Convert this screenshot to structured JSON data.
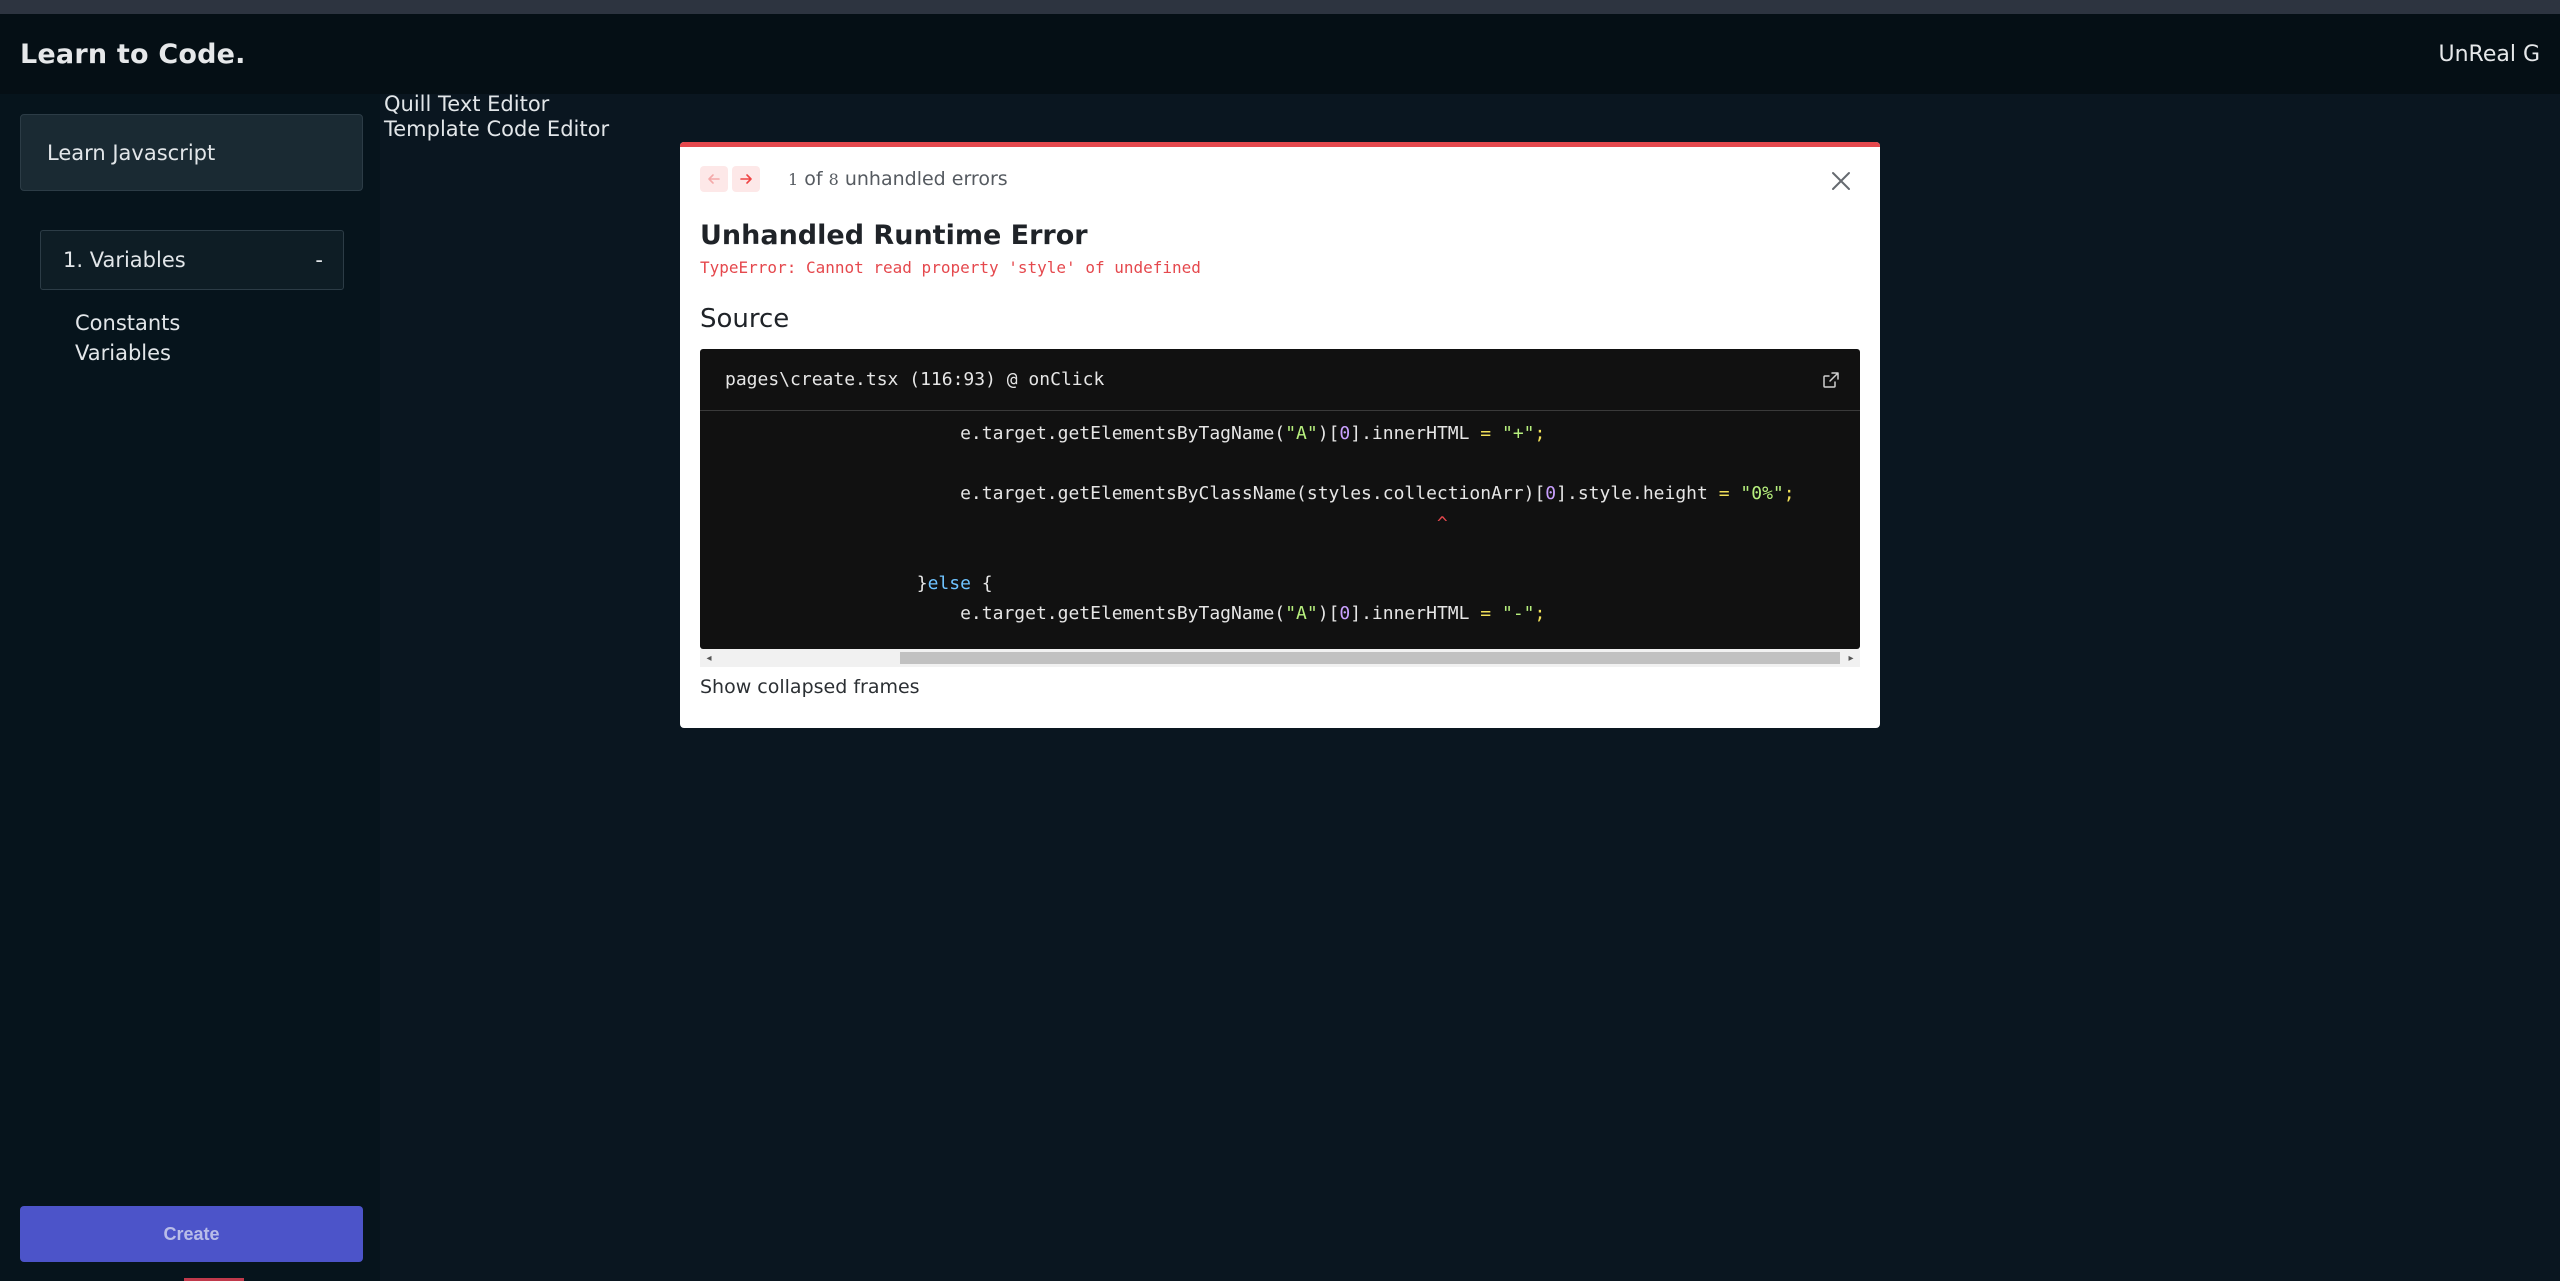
{
  "header": {
    "brand": "Learn to Code.",
    "user_name": "UnReal G"
  },
  "sidebar": {
    "course_title": "Learn Javascript",
    "section": {
      "title": "1. Variables",
      "toggle": "-"
    },
    "lessons": [
      "Constants",
      "Variables"
    ],
    "create_label": "Create"
  },
  "main": {
    "links": [
      "Quill Text Editor",
      "Template Code Editor"
    ]
  },
  "error_overlay": {
    "count_current": "1",
    "count_mid": " of ",
    "count_total": "8",
    "count_suffix": " unhandled errors",
    "title": "Unhandled Runtime Error",
    "message": "TypeError: Cannot read property 'style' of undefined",
    "source_heading": "Source",
    "file_location": "pages\\create.tsx (116:93) @ onClick",
    "show_collapsed": "Show collapsed frames",
    "icons": {
      "prev": "arrow-left-icon",
      "next": "arrow-right-icon",
      "close": "close-icon",
      "open_external": "external-link-icon"
    },
    "colors": {
      "accent": "#e5484d",
      "code_bg": "#111111"
    }
  },
  "code_lines": [
    {
      "indent": "                        ",
      "parts": [
        {
          "t": "e.target.getElementsByTagName(",
          "c": ""
        },
        {
          "t": "\"A\"",
          "c": "str"
        },
        {
          "t": ")[",
          "c": ""
        },
        {
          "t": "0",
          "c": "num"
        },
        {
          "t": "].innerHTML ",
          "c": ""
        },
        {
          "t": "=",
          "c": "op"
        },
        {
          "t": " ",
          "c": ""
        },
        {
          "t": "\"+\"",
          "c": "str"
        },
        {
          "t": ";",
          "c": "op"
        }
      ]
    },
    {
      "indent": "                        ",
      "parts": [
        {
          "t": "e.target.getElementsByClassName(styles.collectionArr)[",
          "c": ""
        },
        {
          "t": "0",
          "c": "num"
        },
        {
          "t": "].style.height ",
          "c": ""
        },
        {
          "t": "=",
          "c": "op"
        },
        {
          "t": " ",
          "c": ""
        },
        {
          "t": "\"0%\"",
          "c": "str"
        },
        {
          "t": ";",
          "c": "op"
        }
      ]
    },
    {
      "indent": "                                                                    ",
      "parts": [
        {
          "t": "^",
          "c": "caret"
        }
      ]
    },
    {
      "indent": "                    ",
      "parts": [
        {
          "t": "}",
          "c": ""
        },
        {
          "t": "else",
          "c": "kw"
        },
        {
          "t": " {",
          "c": ""
        }
      ]
    },
    {
      "indent": "                        ",
      "parts": [
        {
          "t": "e.target.getElementsByTagName(",
          "c": ""
        },
        {
          "t": "\"A\"",
          "c": "str"
        },
        {
          "t": ")[",
          "c": ""
        },
        {
          "t": "0",
          "c": "num"
        },
        {
          "t": "].innerHTML ",
          "c": ""
        },
        {
          "t": "=",
          "c": "op"
        },
        {
          "t": " ",
          "c": ""
        },
        {
          "t": "\"-\"",
          "c": "str"
        },
        {
          "t": ";",
          "c": "op"
        }
      ]
    }
  ]
}
